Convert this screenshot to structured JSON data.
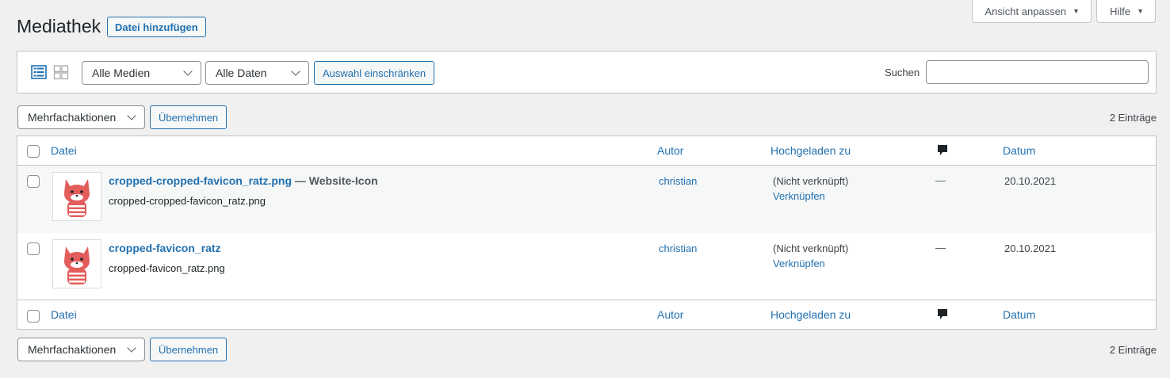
{
  "screen_meta": {
    "view_options_label": "Ansicht anpassen",
    "help_label": "Hilfe"
  },
  "header": {
    "title": "Mediathek",
    "add_button": "Datei hinzufügen"
  },
  "filters": {
    "media_type_selected": "Alle Medien",
    "date_selected": "Alle Daten",
    "filter_button": "Auswahl einschränken",
    "search_label": "Suchen",
    "search_value": ""
  },
  "bulk_top": {
    "action_selected": "Mehrfachaktionen",
    "apply_button": "Übernehmen",
    "count": "2 Einträge"
  },
  "bulk_bottom": {
    "action_selected": "Mehrfachaktionen",
    "apply_button": "Übernehmen",
    "count": "2 Einträge"
  },
  "table": {
    "columns": {
      "file": "Datei",
      "author": "Autor",
      "uploaded_to": "Hochgeladen zu",
      "date": "Datum"
    },
    "rows": [
      {
        "title": "cropped-cropped-favicon_ratz.png",
        "post_state": " — Website-Icon",
        "filename": "cropped-cropped-favicon_ratz.png",
        "author": "christian",
        "uploaded_to": "(Nicht verknüpft)",
        "attach_link": "Verknüpfen",
        "comments": "—",
        "date": "20.10.2021"
      },
      {
        "title": "cropped-favicon_ratz",
        "post_state": "",
        "filename": "cropped-favicon_ratz.png",
        "author": "christian",
        "uploaded_to": "(Nicht verknüpft)",
        "attach_link": "Verknüpfen",
        "comments": "—",
        "date": "20.10.2021"
      }
    ]
  },
  "colors": {
    "accent": "#2271b1",
    "background": "#f0f0f1",
    "thumbnail_cat": "#e35d5b"
  }
}
